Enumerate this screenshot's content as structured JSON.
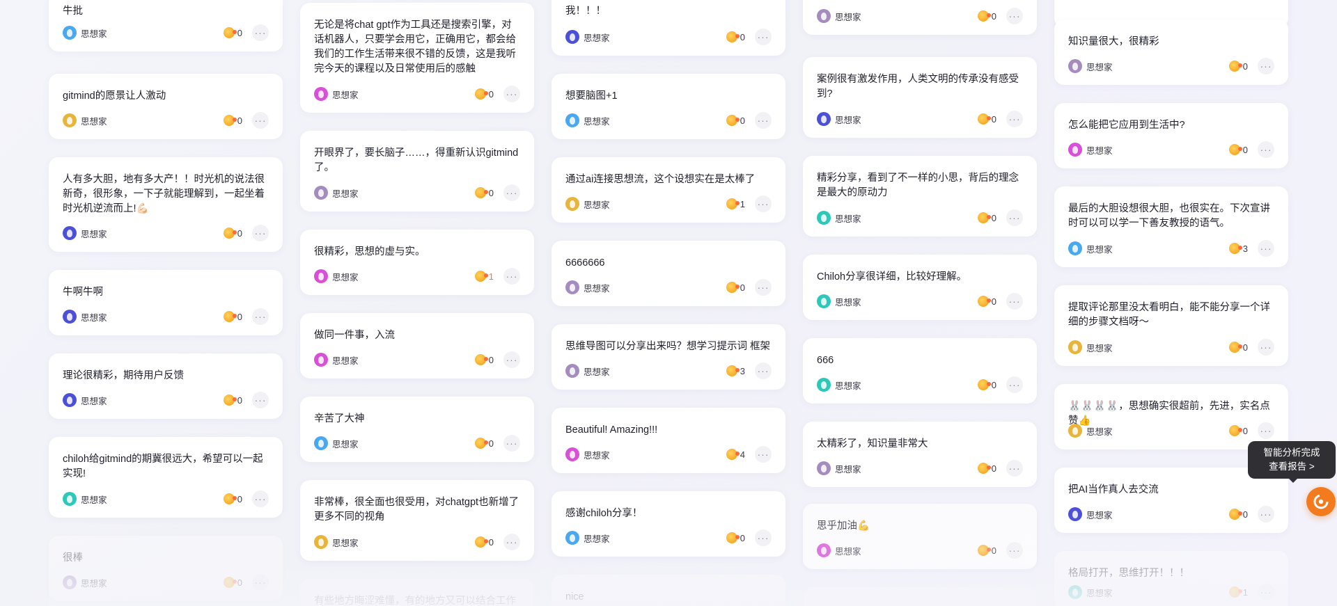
{
  "author_name": "思想家",
  "more_glyph": "···",
  "analysis_tooltip": {
    "line1": "智能分析完成",
    "line2": "查看报告 >"
  },
  "fab_icon": "analysis-refresh-icon",
  "colors": {
    "accent": "#f37b1e",
    "like_active": "#f07a37",
    "avatar_blue": "#4aa8f0",
    "avatar_gold": "#e8b53a",
    "avatar_indigo": "#4c4fd8",
    "avatar_teal": "#2cc8b8",
    "avatar_magenta": "#d84fd8",
    "avatar_mauve": "#a58cbf"
  },
  "columns": [
    {
      "cards": [
        {
          "text": "牛批",
          "avatar": "blue",
          "likes": "0"
        },
        {
          "text": "gitmind的愿景让人激动",
          "avatar": "gold",
          "likes": "0"
        },
        {
          "text": "人有多大胆，地有多大产！！时光机的说法很新奇，很形象，一下子就能理解到，一起坐着时光机逆流而上!💪🏻",
          "avatar": "indigo",
          "likes": "0"
        },
        {
          "text": "牛啊牛啊",
          "avatar": "indigo",
          "likes": "0"
        },
        {
          "text": "理论很精彩，期待用户反馈",
          "avatar": "indigo",
          "likes": "0"
        },
        {
          "text": "chiloh给gitmind的期冀很远大，希望可以一起实现!",
          "avatar": "teal",
          "likes": "0"
        },
        {
          "text": "很棒",
          "avatar": "mauve",
          "likes": "0"
        }
      ]
    },
    {
      "cards": [
        {
          "text": "无论是将chat gpt作为工具还是搜索引擎，对话机器人，只要学会用它，正确用它，都会给我们的工作生活带来很不错的反馈，这是我听完今天的课程以及日常使用后的感触",
          "avatar": "magenta",
          "likes": "0"
        },
        {
          "text": "开眼界了，要长脑子……，得重新认识gitmind了。",
          "avatar": "mauve",
          "likes": "0"
        },
        {
          "text": "很精彩，思想的虚与实。",
          "avatar": "magenta",
          "likes": "1"
        },
        {
          "text": "做同一件事，入流",
          "avatar": "magenta",
          "likes": "0"
        },
        {
          "text": "辛苦了大神",
          "avatar": "blue",
          "likes": "0"
        },
        {
          "text": "非常棒，很全面也很受用，对chatgpt也新增了更多不同的视角",
          "avatar": "gold",
          "likes": "0"
        },
        {
          "text": "有些地方晦涩难懂，有的地方又可以结合工作生",
          "avatar": "mauve",
          "likes": ""
        }
      ]
    },
    {
      "cards": [
        {
          "text": "我！！！",
          "avatar": "indigo",
          "likes": "0"
        },
        {
          "text": "想要脑图+1",
          "avatar": "blue",
          "likes": "0"
        },
        {
          "text": "通过ai连接思想流，这个设想实在是太棒了",
          "avatar": "gold",
          "likes": "1"
        },
        {
          "text": "6666666",
          "avatar": "mauve",
          "likes": "0"
        },
        {
          "text": "思维导图可以分享出来吗？想学习提示词 框架",
          "avatar": "mauve",
          "likes": "3"
        },
        {
          "text": "Beautiful! Amazing!!!",
          "avatar": "magenta",
          "likes": "4"
        },
        {
          "text": "感谢chiloh分享！",
          "avatar": "blue",
          "likes": "0"
        },
        {
          "text": "nice",
          "avatar": "mauve",
          "likes": ""
        }
      ]
    },
    {
      "cards": [
        {
          "text": "",
          "avatar": "mauve",
          "likes": "0"
        },
        {
          "text": "案例很有激发作用，人类文明的传承没有感受到?",
          "avatar": "indigo",
          "likes": "0"
        },
        {
          "text": "精彩分享，看到了不一样的小思，背后的理念是最大的原动力",
          "avatar": "teal",
          "likes": "0"
        },
        {
          "text": "Chiloh分享很详细，比较好理解。",
          "avatar": "teal",
          "likes": "0"
        },
        {
          "text": "666",
          "avatar": "teal",
          "likes": "0"
        },
        {
          "text": "太精彩了，知识量非常大",
          "avatar": "mauve",
          "likes": "0"
        },
        {
          "text": "思乎加油💪",
          "avatar": "magenta",
          "likes": "0"
        }
      ]
    },
    {
      "cards": [
        {
          "text": "知识量很大，很精彩",
          "avatar": "mauve",
          "likes": "0"
        },
        {
          "text": "怎么能把它应用到生活中?",
          "avatar": "magenta",
          "likes": "0"
        },
        {
          "text": "最后的大胆设想很大胆，也很实在。下次宣讲时可以可以学一下善友教授的语气。",
          "avatar": "blue",
          "likes": "3"
        },
        {
          "text": "提取评论那里没太看明白，能不能分享一个详细的步骤文档呀～",
          "avatar": "gold",
          "likes": "0"
        },
        {
          "text": "🐰🐰🐰🐰，思想确实很超前，先进，实名点赞👍",
          "avatar": "gold",
          "likes": "0"
        },
        {
          "text": "把AI当作真人去交流",
          "avatar": "indigo",
          "likes": "0"
        },
        {
          "text": "格局打开，思维打开！！！",
          "avatar": "teal",
          "likes": "1"
        }
      ]
    }
  ]
}
